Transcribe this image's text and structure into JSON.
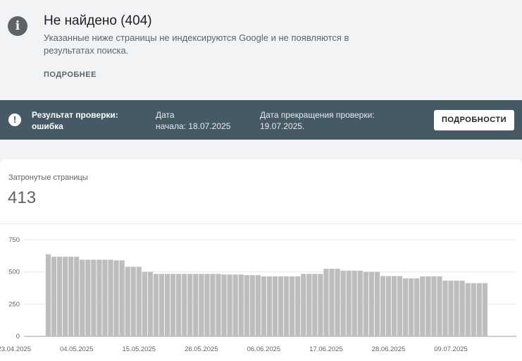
{
  "header": {
    "title": "Не найдено (404)",
    "description": "Указанные ниже страницы не индексируются Google и не появляются в результатах поиска.",
    "more_link": "ПОДРОБНЕЕ",
    "info_icon": "info-icon"
  },
  "validation": {
    "result_label": "Результат проверки:",
    "result_value": "ошибка",
    "start_label": "Дата",
    "start_value": "начала: 18.07.2025",
    "end_label": "Дата прекращения проверки:",
    "end_value": "19.07.2025.",
    "details_button": "ПОДРОБНОСТИ",
    "icon": "alert-circle-icon",
    "background": "#455a64"
  },
  "summary": {
    "label": "Затронутые страницы",
    "value": "413"
  },
  "chart_data": {
    "type": "bar",
    "ylim": [
      0,
      750
    ],
    "yticks": [
      0,
      250,
      500,
      750
    ],
    "ytick_labels": [
      "0",
      "250",
      "500",
      "750"
    ],
    "bar_color": "#bdbdbd",
    "grid": true,
    "x_tick_labels": [
      "23.04.2025",
      "04.05.2025",
      "15.05.2025",
      "26.05.2025",
      "06.06.2025",
      "17.06.2025",
      "28.06.2025",
      "09.07.2025"
    ],
    "x_tick_day_index": [
      0,
      11,
      22,
      33,
      44,
      55,
      66,
      77
    ],
    "values": [
      0,
      0,
      0,
      0,
      0,
      0,
      637,
      618,
      618,
      618,
      618,
      618,
      595,
      595,
      595,
      595,
      595,
      595,
      590,
      590,
      540,
      540,
      540,
      500,
      500,
      485,
      485,
      485,
      485,
      485,
      485,
      485,
      485,
      485,
      485,
      485,
      485,
      480,
      480,
      480,
      480,
      475,
      475,
      475,
      465,
      465,
      465,
      465,
      465,
      465,
      465,
      485,
      485,
      485,
      485,
      525,
      525,
      525,
      510,
      510,
      510,
      510,
      500,
      500,
      500,
      468,
      468,
      468,
      468,
      450,
      450,
      450,
      465,
      465,
      465,
      465,
      432,
      432,
      432,
      432,
      413,
      413,
      413,
      413
    ]
  }
}
